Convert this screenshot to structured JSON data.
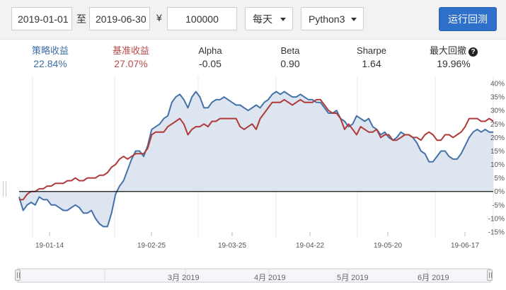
{
  "toolbar": {
    "start_date": "2019-01-01",
    "to_label": "至",
    "end_date": "2019-06-30",
    "currency_symbol": "¥",
    "capital": "100000",
    "frequency": "每天",
    "language": "Python3",
    "run_label": "运行回测"
  },
  "stats": [
    {
      "label": "策略收益",
      "value": "22.84%"
    },
    {
      "label": "基准收益",
      "value": "27.07%"
    },
    {
      "label": "Alpha",
      "value": "-0.05"
    },
    {
      "label": "Beta",
      "value": "0.90"
    },
    {
      "label": "Sharpe",
      "value": "1.64"
    },
    {
      "label": "最大回撤",
      "value": "19.96%"
    }
  ],
  "colors": {
    "strategy": "#4472a8",
    "benchmark": "#b03a3a",
    "stat_strategy": "#3c6fa8",
    "stat_benchmark": "#b94a4a",
    "area_fill": "#dde5f0",
    "accent_button": "#2d6fc9"
  },
  "icons": {
    "drawdown_help": "question-circle-icon"
  },
  "navigator": {
    "labels": [
      "3月 2019",
      "4月 2019",
      "5月 2019",
      "6月 2019"
    ]
  },
  "chart_data": {
    "type": "line",
    "x_tick_labels": [
      "19-01-14",
      "19-02-25",
      "19-03-25",
      "19-04-22",
      "19-05-20",
      "19-06-17"
    ],
    "y_tick_labels": [
      "40%",
      "35%",
      "30%",
      "25%",
      "20%",
      "15%",
      "10%",
      "5%",
      "0%",
      "-5%",
      "-10%",
      "-15%"
    ],
    "ylim": [
      -15,
      40
    ],
    "grid": true,
    "series": [
      {
        "values": [
          -2,
          -7,
          -5,
          -4,
          -5,
          -2,
          -3,
          -3,
          -5,
          -5,
          -6,
          -7,
          -7,
          -6,
          -5,
          -6,
          -8,
          -8,
          -7,
          -10,
          -12,
          -13,
          -13,
          -8,
          -1,
          2,
          4,
          8,
          12,
          15,
          15,
          13,
          17,
          23,
          24,
          25,
          27,
          28,
          33,
          35,
          36,
          34,
          31,
          35,
          37,
          35,
          31,
          31,
          33,
          34,
          34,
          35,
          34,
          33,
          32,
          32,
          31,
          30,
          31,
          32,
          31,
          33,
          34,
          36,
          37,
          36,
          37,
          36,
          35,
          35,
          36,
          35,
          34,
          34,
          33,
          33,
          31,
          29,
          29,
          30,
          27,
          26,
          24,
          25,
          28,
          27,
          26,
          27,
          24,
          23,
          21,
          22,
          20,
          19,
          20,
          22,
          21,
          21,
          20,
          18,
          15,
          14,
          11,
          11,
          13,
          15,
          15,
          13,
          12,
          12,
          14,
          17,
          20,
          22,
          23,
          22,
          23,
          22,
          22
        ]
      },
      {
        "values": [
          -3,
          -3,
          -1,
          0,
          0,
          1,
          1,
          2,
          2,
          3,
          3,
          3,
          4,
          4,
          5,
          4,
          4,
          5,
          5,
          5,
          6,
          6,
          7,
          9,
          10,
          12,
          13,
          12,
          13,
          14,
          14,
          14,
          16,
          21,
          22,
          22,
          22,
          24,
          25,
          26,
          27,
          25,
          21,
          23,
          24,
          24,
          25,
          24,
          26,
          26,
          27,
          27,
          27,
          27,
          27,
          24,
          23,
          24,
          25,
          23,
          27,
          29,
          31,
          33,
          33,
          33,
          34,
          33,
          32,
          33,
          34,
          33,
          33,
          33,
          34,
          34,
          32,
          30,
          29,
          29,
          27,
          23,
          25,
          23,
          21,
          24,
          23,
          22,
          22,
          23,
          20,
          21,
          21,
          19,
          19,
          20,
          21,
          21,
          20,
          20,
          19,
          21,
          22,
          21,
          19,
          19,
          21,
          21,
          20,
          21,
          22,
          24,
          27,
          27,
          27,
          26,
          26,
          27,
          26
        ]
      }
    ]
  }
}
